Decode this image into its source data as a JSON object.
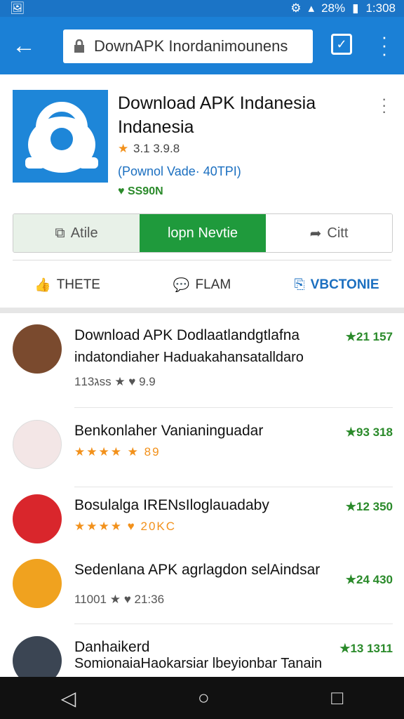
{
  "status": {
    "battery": "28%",
    "time": "1:308"
  },
  "toolbar": {
    "url_text": "DownAPK Inordanimounens"
  },
  "app": {
    "title": "Download APK Indanesia Indanesia",
    "rating": "3.1 3.9.8",
    "developer": "(Pownol Vade· 40TPI)",
    "size": "SS90N"
  },
  "buttons": {
    "left": "Atile",
    "middle": "lopn Nevtie",
    "right": "Citt"
  },
  "actions": {
    "like": "THETE",
    "comment": "FLAM",
    "share": "VBCTONIE"
  },
  "list": [
    {
      "title": "Download APK Dodlaatlandgtlafna",
      "subtitle": "indatondiaher Haduakahansatalldaro",
      "meta": "11ג3ss ★  ♥ 9.9",
      "score": "★21 157"
    },
    {
      "title": "Benkonlaher Vanianinguadar",
      "subtitle": "",
      "meta": "★★★★ ★ 89",
      "score": "★93 318"
    },
    {
      "title": "Bosulalga IRENsIloglauadaby",
      "subtitle": "",
      "meta": "★★★★ ♥ 20KC",
      "score": "★12 350"
    },
    {
      "title": "Sedenlana APK agrlagdon selAindsar",
      "subtitle": "",
      "meta": "11001 ★  ♥ 21:36",
      "score": "★24 430"
    },
    {
      "title": "Danhaikerd",
      "subtitle": "SomionaiaHaokarsiar lbeyionbar Tanain",
      "meta": "",
      "score": "★13 1311"
    }
  ],
  "colors": {
    "primary": "#1b80d6",
    "accent_green": "#1f9a3c"
  }
}
